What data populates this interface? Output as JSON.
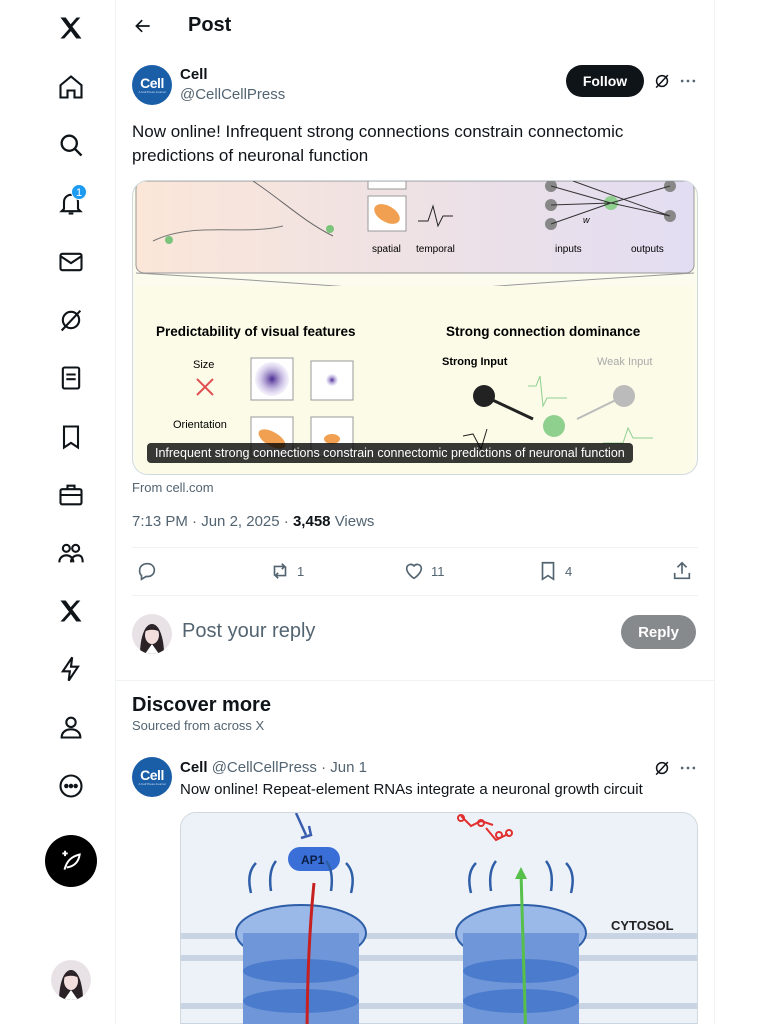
{
  "nav": {
    "notifications_badge": "1",
    "accent": "#1d9bf0"
  },
  "header": {
    "title": "Post"
  },
  "post": {
    "author_name": "Cell",
    "author_handle": "@CellCellPress",
    "avatar_text": "Cell",
    "avatar_subtext": "A Cell Press Journal",
    "follow_label": "Follow",
    "text": "Now online!  Infrequent strong connections constrain connectomic predictions of neuronal function",
    "media": {
      "caption": "Infrequent strong connections constrain connectomic predictions of neuronal function",
      "labels": {
        "spatial": "spatial",
        "temporal": "temporal",
        "w": "w",
        "inputs": "inputs",
        "outputs": "outputs",
        "left_title": "Predictability of visual features",
        "right_title": "Strong connection dominance",
        "size": "Size",
        "orientation": "Orientation",
        "strong_input": "Strong Input",
        "weak_input": "Weak Input"
      }
    },
    "source": "From cell.com",
    "time": "7:13 PM",
    "date": "Jun 2, 2025",
    "views_count": "3,458",
    "views_label": "Views",
    "reposts": "1",
    "likes": "11",
    "bookmarks": "4"
  },
  "reply": {
    "placeholder": "Post your reply",
    "button": "Reply"
  },
  "discover": {
    "title": "Discover more",
    "subtitle": "Sourced from across X"
  },
  "post2": {
    "author_name": "Cell",
    "author_handle": "@CellCellPress",
    "separator": "·",
    "date": "Jun 1",
    "text": "Now online!  Repeat-element RNAs integrate a neuronal growth circuit",
    "media_labels": {
      "ap1": "AP1",
      "cytosol": "CYTOSOL"
    }
  }
}
